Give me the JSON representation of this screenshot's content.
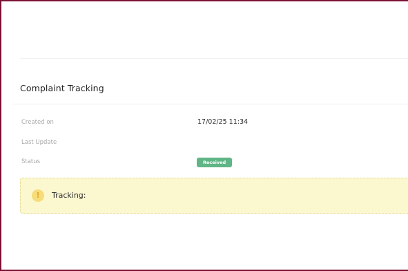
{
  "section": {
    "title": "Complaint Tracking"
  },
  "details": {
    "created_label": "Created on",
    "created_value": "17/02/25 11:34",
    "updated_label": "Last Update",
    "updated_value": "",
    "status_label": "Status",
    "status_value": "Received"
  },
  "tracking": {
    "icon": "exclamation-icon",
    "label": "Tracking:"
  },
  "colors": {
    "frame_border": "#7a1035",
    "status_badge": "#5fb585",
    "tracking_background": "#fbf7cf",
    "warning_icon": "#f6dc7a"
  }
}
